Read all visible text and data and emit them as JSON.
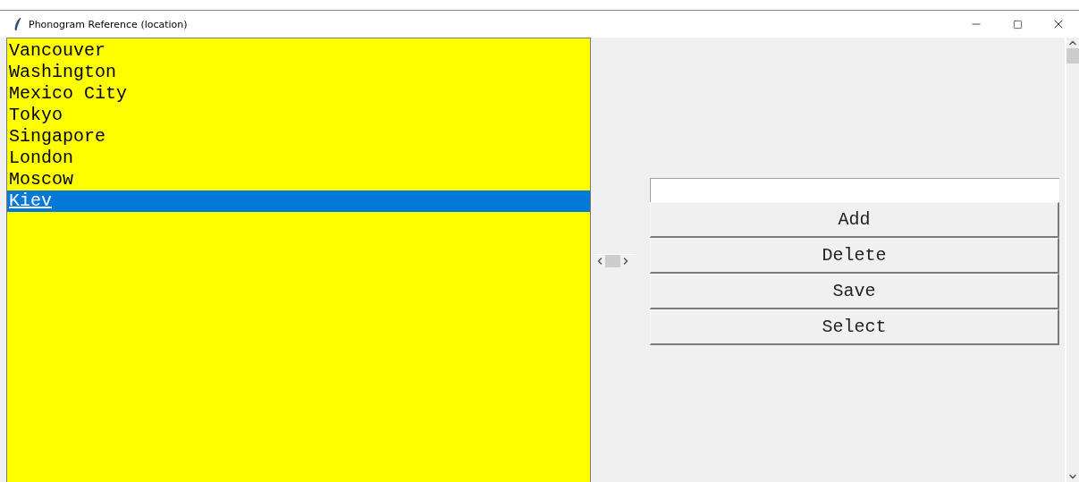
{
  "window": {
    "title": "Phonogram Reference (location)"
  },
  "list": {
    "items": [
      {
        "label": "Vancouver",
        "selected": false
      },
      {
        "label": "Washington",
        "selected": false
      },
      {
        "label": "Mexico City",
        "selected": false
      },
      {
        "label": "Tokyo",
        "selected": false
      },
      {
        "label": "Singapore",
        "selected": false
      },
      {
        "label": "London",
        "selected": false
      },
      {
        "label": "Moscow",
        "selected": false
      },
      {
        "label": "Kiev",
        "selected": true
      }
    ]
  },
  "buttons": [
    "Add",
    "Delete",
    "Save",
    "Select"
  ]
}
